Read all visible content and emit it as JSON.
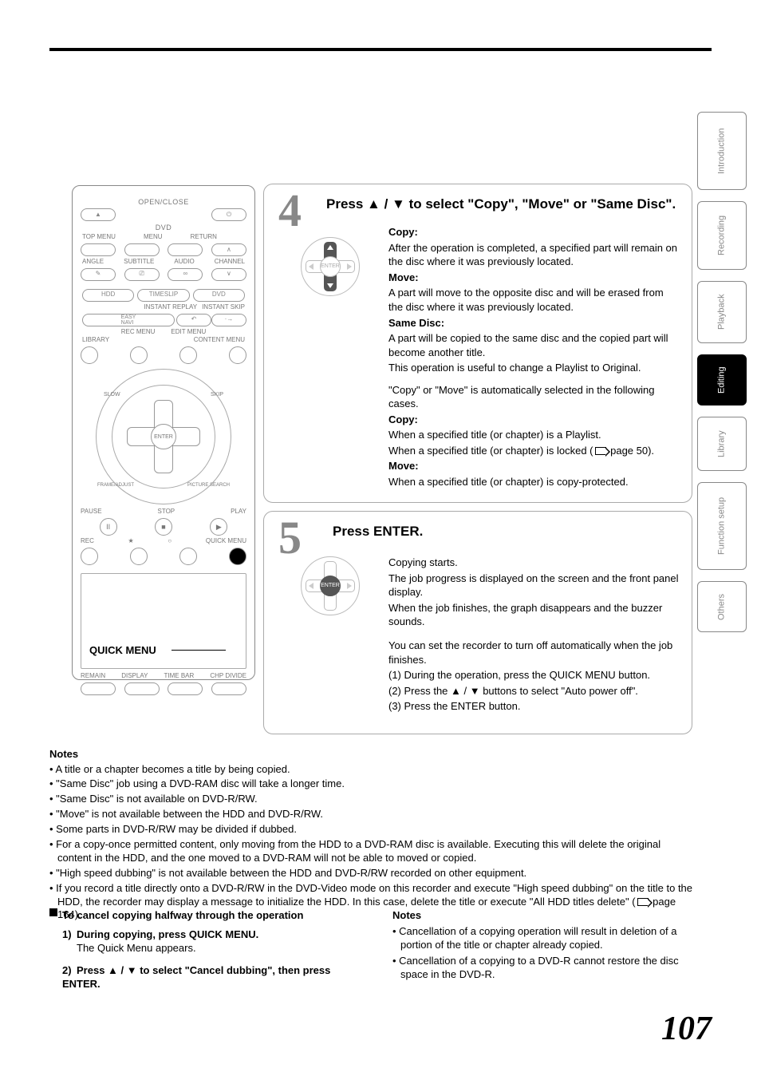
{
  "sidetabs": [
    "Introduction",
    "Recording",
    "Playback",
    "Editing",
    "Library",
    "Function setup",
    "Others"
  ],
  "active_tab_index": 3,
  "remote": {
    "open_close": "OPEN/CLOSE",
    "dvd": "DVD",
    "r1": [
      "TOP MENU",
      "MENU",
      "RETURN"
    ],
    "angle": "ANGLE",
    "subtitle": "SUBTITLE",
    "audio": "AUDIO",
    "channel": "CHANNEL",
    "hdd": "HDD",
    "timeslip": "TIMESLIP",
    "dvd2": "DVD",
    "instant_replay": "INSTANT REPLAY",
    "instant_skip": "INSTANT SKIP",
    "easy_navi": "EASY NAVI",
    "rec_menu": "REC MENU",
    "edit_menu": "EDIT MENU",
    "library": "LIBRARY",
    "content_menu": "CONTENT MENU",
    "enter": "ENTER",
    "slow": "SLOW",
    "skip": "SKIP",
    "frame_adjust": "FRAME/ADJUST",
    "picture_search": "PICTURE SEARCH",
    "pause": "PAUSE",
    "stop": "STOP",
    "play": "PLAY",
    "rec": "REC",
    "quick_menu": "QUICK MENU",
    "remain": "REMAIN",
    "display": "DISPLAY",
    "timebar": "TIME BAR",
    "chpdivide": "CHP DIVIDE"
  },
  "quick_menu_callout": "QUICK MENU",
  "step4": {
    "num": "4",
    "title": "Press ▲ / ▼ to select \"Copy\", \"Move\" or \"Same Disc\".",
    "copy_h": "Copy:",
    "copy_t": "After the operation is completed, a specified part will remain on the disc where it was previously located.",
    "move_h": "Move:",
    "move_t": "A part will move to the opposite disc and will be erased from the disc where it was previously located.",
    "same_h": "Same Disc:",
    "same_t1": "A part will be copied to the same disc and the copied part will become another title.",
    "same_t2": "This operation is useful to change a Playlist to Original.",
    "auto_t": "\"Copy\" or \"Move\" is automatically selected in the following cases.",
    "copy2_h": "Copy:",
    "copy2_t1": "When a specified title (or chapter) is a Playlist.",
    "copy2_t2_a": "When a specified title (or chapter) is locked (",
    "copy2_t2_b": " page 50).",
    "move2_h": "Move:",
    "move2_t": "When a specified title (or chapter) is copy-protected."
  },
  "step5": {
    "num": "5",
    "title": "Press ENTER.",
    "p1": "Copying starts.",
    "p2": "The job progress is displayed on the screen and the front panel display.",
    "p3": "When the job finishes, the graph disappears and the buzzer sounds.",
    "p4": "You can set the recorder to turn off automatically when the job finishes.",
    "l1": "(1) During the operation, press the QUICK MENU button.",
    "l2": "(2) Press the ▲ / ▼ buttons to select \"Auto power off\".",
    "l3": "(3) Press the ENTER button.",
    "enter": "ENTER"
  },
  "notes": {
    "heading": "Notes",
    "items": [
      "A title or a chapter becomes a title by being copied.",
      "\"Same Disc\" job using a DVD-RAM disc will take a longer time.",
      "\"Same Disc\" is not available on DVD-R/RW.",
      "\"Move\" is not available between the HDD and DVD-R/RW.",
      "Some parts in DVD-R/RW may be divided if dubbed.",
      "For a copy-once permitted content, only moving from the HDD to a DVD-RAM disc is available. Executing this will delete the original content in the HDD, and the one moved to a DVD-RAM will not be able to moved or copied.",
      "\"High speed dubbing\" is not available between the HDD and DVD-R/RW recorded on other equipment."
    ],
    "last_a": "If you record a title directly onto a DVD-R/RW in the DVD-Video mode on this recorder and execute \"High speed dubbing\" on the title to the HDD, the recorder may display a message to initialize the HDD. In this case, delete the title or execute \"All HDD titles delete\" (",
    "last_b": " page 164)."
  },
  "cancel": {
    "title": "To cancel copying halfway through the operation",
    "s1_h": "During copying, press QUICK MENU.",
    "s1_t": "The Quick Menu appears.",
    "s2_h": "Press ▲ / ▼ to select \"Cancel dubbing\", then press ENTER."
  },
  "notes2": {
    "heading": "Notes",
    "items": [
      "Cancellation of a copying operation will result in deletion of a portion of the title or chapter already copied.",
      "Cancellation of a copying to a DVD-R cannot restore the disc space in the DVD-R."
    ]
  },
  "page_number": "107"
}
